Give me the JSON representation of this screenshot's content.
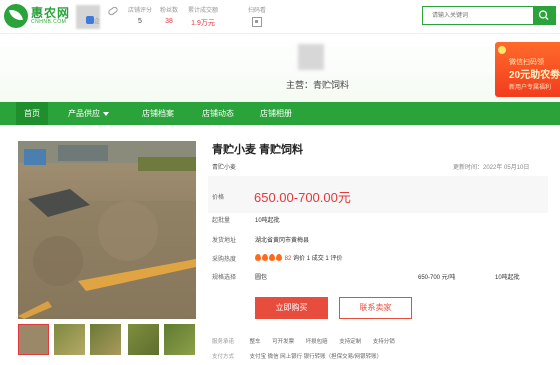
{
  "brand": {
    "name": "惠农网",
    "sub": "CNHNB.COM"
  },
  "shop": {
    "vip_text": "企"
  },
  "stats": [
    {
      "label": "店铺评分",
      "value": "5"
    },
    {
      "label": "粉丝数",
      "value": "38"
    },
    {
      "label": "累计成交额",
      "value": "1.9万元"
    }
  ],
  "qr_label": "扫码看",
  "search": {
    "placeholder": "请输入关键词"
  },
  "shop_header": {
    "main_business": "主营：青贮饲料"
  },
  "promo": {
    "line1": "微信扫码领",
    "line2": "20元助农劵",
    "line3": "新用户专属福利"
  },
  "nav": {
    "home": "首页",
    "products": "产品供应",
    "profile": "店铺档案",
    "news": "店铺动态",
    "recommend": "店铺相册"
  },
  "product": {
    "title": "青贮小麦 青贮饲料",
    "category": "青贮小麦",
    "updated": "更新时间：2022年 05月10日",
    "price_label": "价格",
    "price": "650.00-700.00元",
    "moq_label": "起批量",
    "moq": "10吨起批",
    "origin_label": "发货地址",
    "origin": "湖北省黄冈市黄梅县",
    "heat_label": "采购热度",
    "heat_num": "82",
    "heat_rest": "询价  1 成交  1 评价",
    "spec_label": "规格选择",
    "spec_name": "圆包",
    "spec_price": "650-700 元/吨",
    "spec_moq": "10吨起批",
    "buy_btn": "立即购买",
    "contact_btn": "联系卖家",
    "service_label": "服务承诺",
    "services": [
      "整车",
      "可开发票",
      "坏损包赔",
      "支持定制",
      "支持分销"
    ],
    "pay_label": "支付方式",
    "payments": "支付宝 微信 网上银行 银行转账（担保交易/网银转账）"
  }
}
